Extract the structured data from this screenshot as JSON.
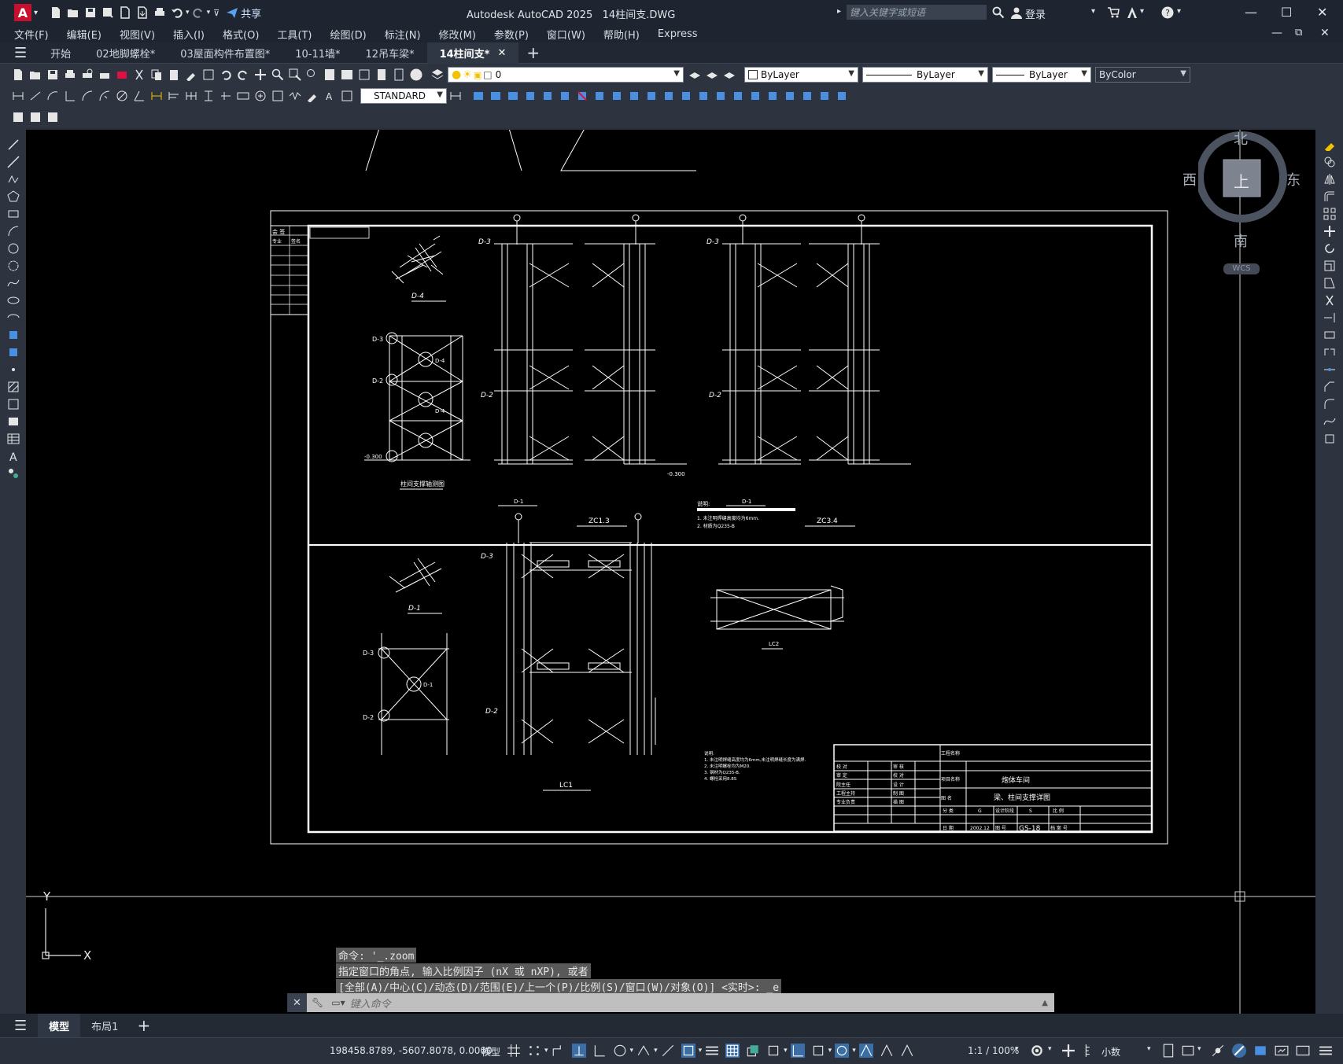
{
  "title_bar": {
    "app_title": "Autodesk AutoCAD 2025",
    "file_name": "14柱间支.DWG",
    "share_label": "共享",
    "search_placeholder": "键入关键字或短语",
    "login_label": "登录"
  },
  "menu": [
    "文件(F)",
    "编辑(E)",
    "视图(V)",
    "插入(I)",
    "格式(O)",
    "工具(T)",
    "绘图(D)",
    "标注(N)",
    "修改(M)",
    "参数(P)",
    "窗口(W)",
    "帮助(H)",
    "Express"
  ],
  "tabs": [
    {
      "label": "开始",
      "active": false
    },
    {
      "label": "02地脚螺栓*",
      "active": false
    },
    {
      "label": "03屋面构件布置图*",
      "active": false
    },
    {
      "label": "10-11墙*",
      "active": false
    },
    {
      "label": "12吊车梁*",
      "active": false
    },
    {
      "label": "14柱间支*",
      "active": true
    }
  ],
  "properties": {
    "layer_value": "0",
    "color": "ByLayer",
    "linetype": "ByLayer",
    "lineweight": "ByLayer",
    "plotstyle": "ByColor",
    "text_style": "STANDARD"
  },
  "viewcube": {
    "north": "北",
    "south": "南",
    "east": "东",
    "west": "西",
    "top": "上",
    "wcs": "WCS"
  },
  "ucs": {
    "x": "X",
    "y": "Y"
  },
  "drawing": {
    "labels": {
      "d4": "D-4",
      "d3": "D-3",
      "d2": "D-2",
      "d1": "D-1",
      "elev1": "-0.300",
      "elev2": "-0.300",
      "bottom_label1": "D-1",
      "bottom_label2": "D-1",
      "zc1": "ZC1.3",
      "zc2": "ZC3.4",
      "section_title": "柱间支撑轴测图",
      "notes_title": "说明:",
      "notes1": "1. 未注明焊缝高度均为6mm.",
      "notes2": "2. 材质为Q235-B",
      "lc1": "LC1",
      "lc2": "LC2",
      "notes_b_title": "说明:",
      "notes_b1": "1. 未注明焊缝高度均为6mm,未注明焊缝长度为满焊.",
      "notes_b2": "2. 未注明螺栓均为M20.",
      "notes_b3": "3. 钢材为Q235-B.",
      "notes_b4": "4. 螺栓采用8.8S"
    },
    "title_block": {
      "project_name_label": "工程名称",
      "project_label": "项目名称",
      "project_value": "炮体车间",
      "drawing_label": "图 名",
      "drawing_value": "梁、柱间支撑详图",
      "rows": [
        [
          "校 对",
          "审 核"
        ],
        [
          "审 定",
          "校 对"
        ],
        [
          "院主任",
          "设 计"
        ],
        [
          "工程主持",
          "制 图"
        ],
        [
          "专业负责",
          "描 图"
        ]
      ],
      "division_label": "分 类",
      "division_value": "G",
      "design_stage_label": "设计阶段",
      "design_stage_value": "S",
      "scale_label": "比 例",
      "date_label": "日 期",
      "date_value": "2002.12",
      "sheet_label": "图 号",
      "sheet_value": "GS-18",
      "sheet_no_label": "档 案 号"
    },
    "stamp_headers": [
      "会 签",
      "专业",
      "签名"
    ]
  },
  "command_history": [
    "命令: '_.zoom",
    "指定窗口的角点, 输入比例因子 (nX 或 nXP), 或者",
    "[全部(A)/中心(C)/动态(D)/范围(E)/上一个(P)/比例(S)/窗口(W)/对象(O)] <实时>: _e"
  ],
  "command_input_placeholder": "键入命令",
  "layout_tabs": [
    {
      "label": "模型",
      "active": true
    },
    {
      "label": "布局1",
      "active": false
    }
  ],
  "status": {
    "coords": "198458.8789, -5607.8078, 0.0000",
    "model_label": "模型",
    "scale": "1:1 / 100%",
    "units": "小数"
  }
}
